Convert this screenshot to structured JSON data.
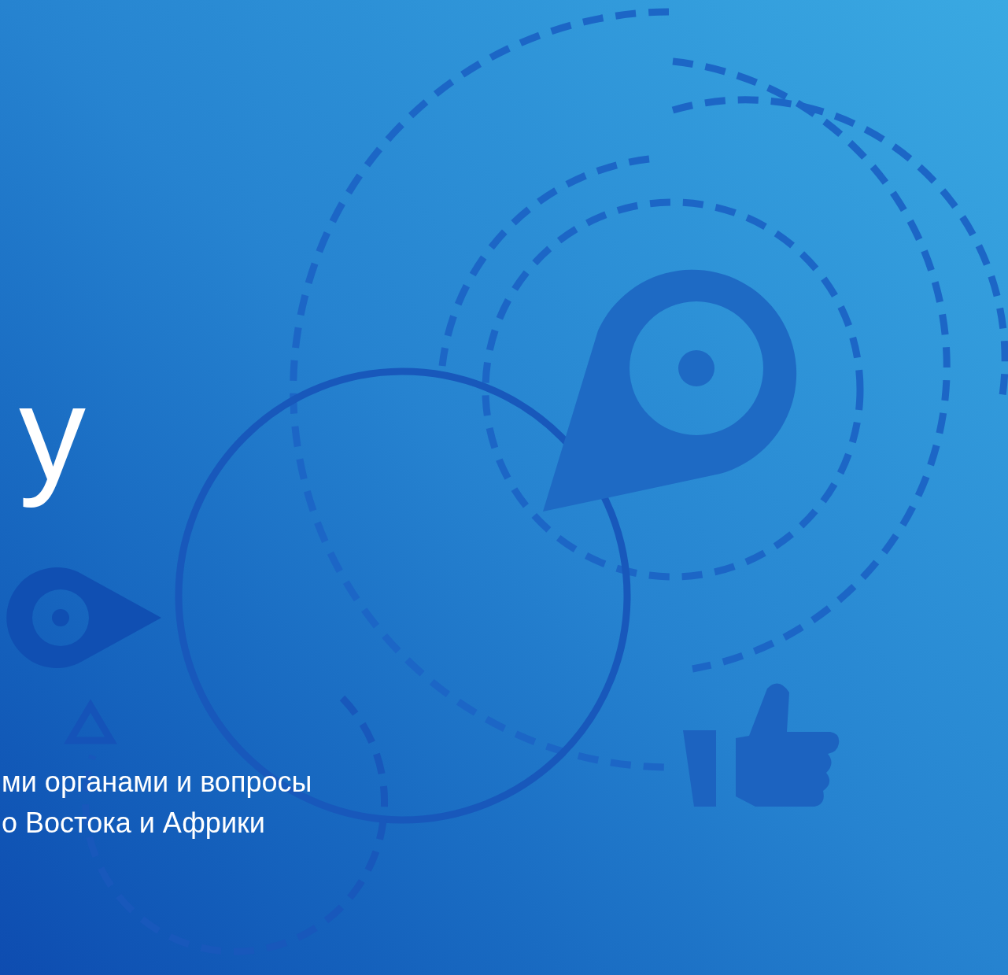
{
  "hero": {
    "title": "у",
    "subtitle_lines": [
      "ми органами и вопросы",
      "о Востока и Африки"
    ]
  }
}
